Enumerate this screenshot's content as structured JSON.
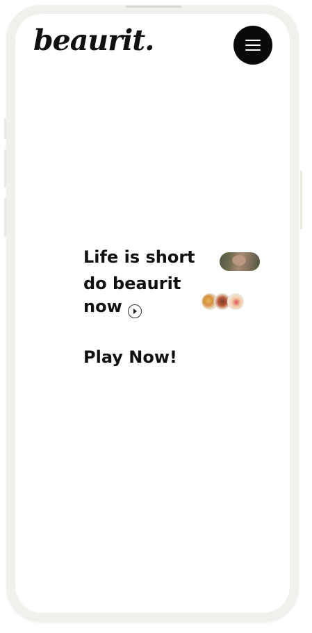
{
  "header": {
    "logo_text": "beaurit.",
    "menu_icon": "hamburger-menu-icon"
  },
  "hero": {
    "line1": "Life is short",
    "line2": "do beaurit",
    "line3": "now",
    "play_icon": "play-circle-icon",
    "cta_label": "Play Now!"
  },
  "colors": {
    "background": "#ffffff",
    "text": "#111111",
    "menu_button": "#0a0a0a",
    "device_frame": "#f1f0ec"
  }
}
